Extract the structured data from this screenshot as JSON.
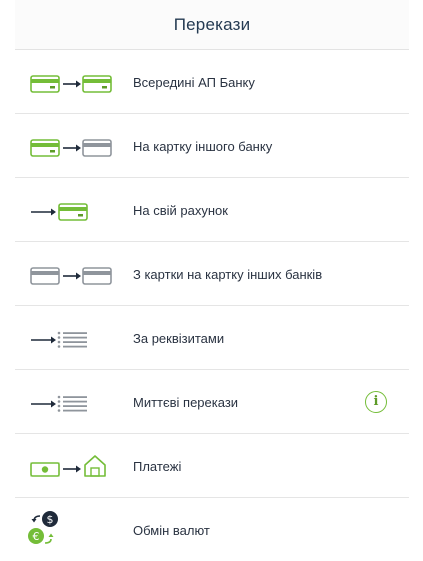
{
  "screen": {
    "title": "Перекази"
  },
  "menu": [
    {
      "label": "Всередині АП Банку",
      "icon": "green-card-to-green-card-icon"
    },
    {
      "label": "На картку іншого банку",
      "icon": "green-card-to-gray-card-icon"
    },
    {
      "label": "На свій рахунок",
      "icon": "arrow-to-green-card-icon"
    },
    {
      "label": "З картки на картку інших банків",
      "icon": "gray-card-to-gray-card-icon"
    },
    {
      "label": "За реквізитами",
      "icon": "arrow-to-list-icon"
    },
    {
      "label": "Миттєві перекази",
      "icon": "arrow-to-list-icon",
      "info_label": "i"
    },
    {
      "label": "Платежі",
      "icon": "cash-to-house-icon"
    },
    {
      "label": "Обмін валют",
      "icon": "currency-exchange-icon"
    }
  ],
  "colors": {
    "accent_green": "#74bd38",
    "dark_green": "#5d9b28",
    "gray_card": "#8f959c",
    "dark_icon": "#1f2a3a",
    "title": "#243a52"
  }
}
